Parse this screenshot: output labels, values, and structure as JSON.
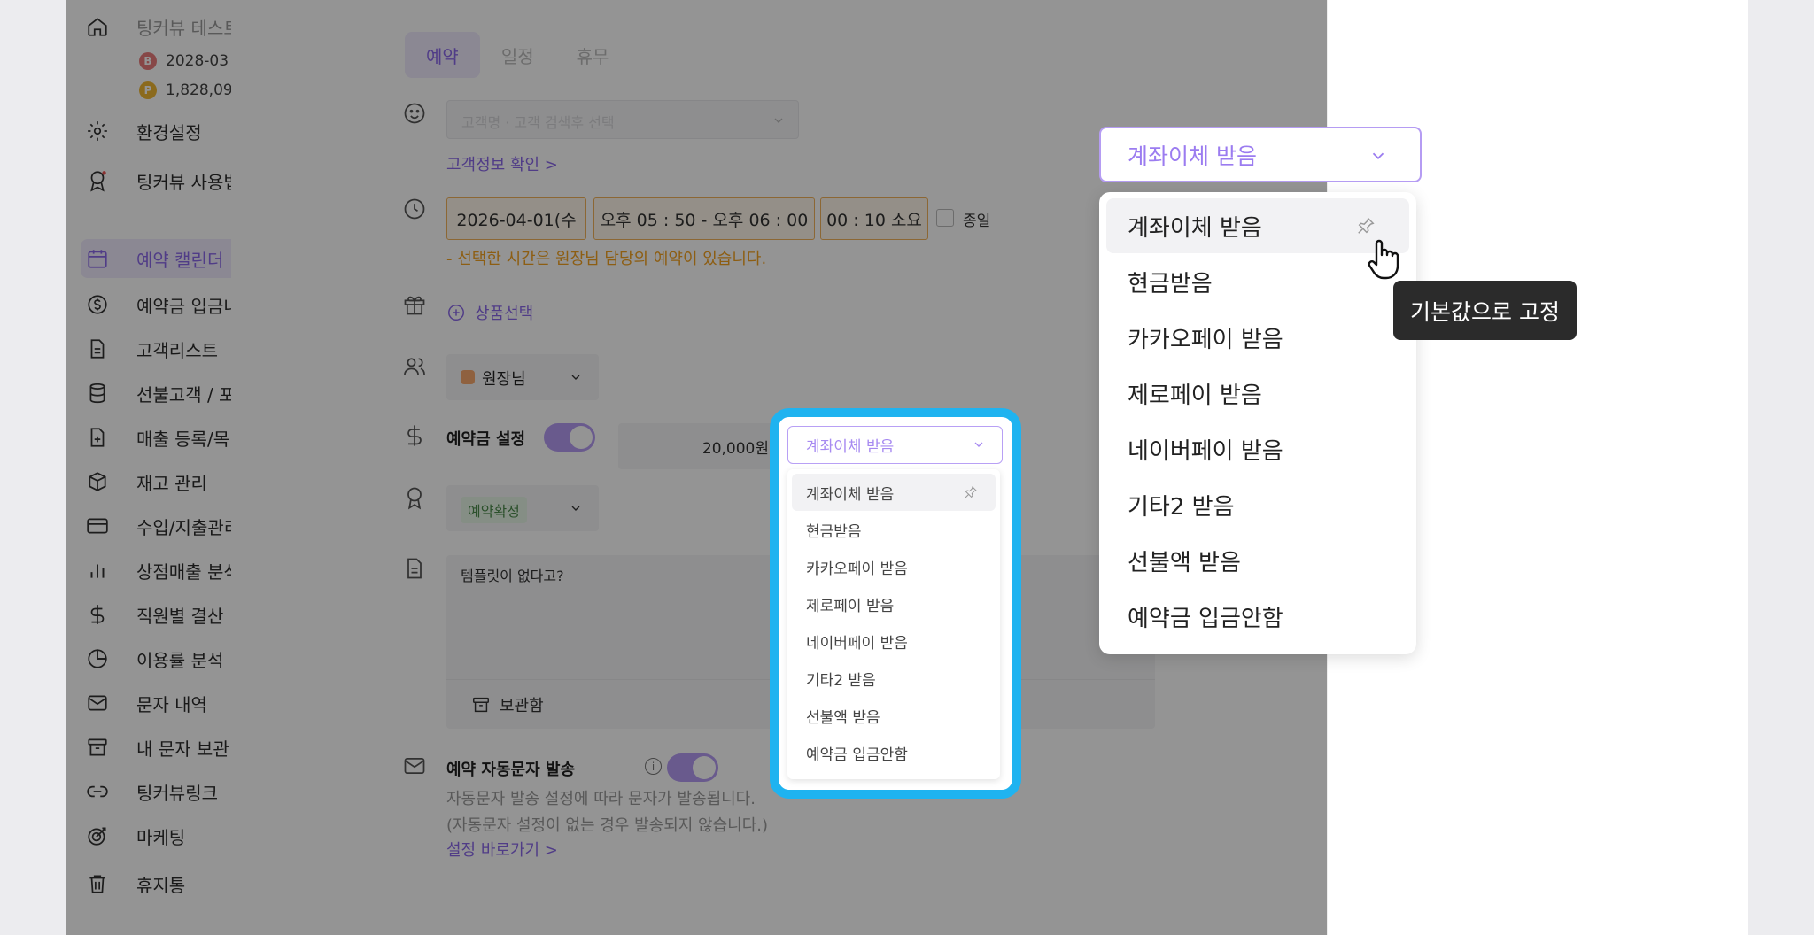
{
  "sidebar": {
    "top_name": "팅커뷰 테스트",
    "sub1": "2028-03",
    "sub2": "1,828,09",
    "items": [
      {
        "label": "환경설정"
      },
      {
        "label": "팅커뷰 사용법"
      },
      {
        "label": "예약 캘린더"
      },
      {
        "label": "예약금 입금내"
      },
      {
        "label": "고객리스트"
      },
      {
        "label": "선불고객 / 포"
      },
      {
        "label": "매출 등록/목"
      },
      {
        "label": "재고 관리"
      },
      {
        "label": "수입/지출관리"
      },
      {
        "label": "상점매출 분석"
      },
      {
        "label": "직원별 결산"
      },
      {
        "label": "이용률 분석"
      },
      {
        "label": "문자 내역"
      },
      {
        "label": "내 문자 보관"
      },
      {
        "label": "팅커뷰링크"
      },
      {
        "label": "마케팅"
      },
      {
        "label": "휴지통"
      }
    ]
  },
  "form": {
    "tabs": [
      "예약",
      "일정",
      "휴무"
    ],
    "customer_select": "고객명 · 고객 검색후 선택",
    "customer_link": "고객정보 확인 >",
    "date": "2026-04-01(수",
    "time_range": "오후 05 : 50 - 오후 06 : 00",
    "duration": "00 : 10 소요",
    "allday_label": "종일",
    "warning": "- 선택한 시간은 원장님 담당의 예약이 있습니다.",
    "product_label": "상품선택",
    "staff": "원장님",
    "deposit_label": "예약금 설정",
    "deposit_amount": "20,000원",
    "status_badge": "예약확정",
    "memo_text": "템플릿이 없다고?",
    "memo_storage": "보관함",
    "sms_label": "예약 자동문자 발송",
    "sms_desc1": "자동문자 발송 설정에 따라 문자가 발송됩니다.",
    "sms_desc2": "(자동문자 설정이 없는 경우 발송되지 않습니다.)",
    "sms_link": "설정 바로가기 >"
  },
  "small_dropdown": {
    "selected": "계좌이체 받음",
    "options": [
      "계좌이체 받음",
      "현금받음",
      "카카오페이 받음",
      "제로페이 받음",
      "네이버페이 받음",
      "기타2 받음",
      "선불액 받음",
      "예약금 입금안함"
    ]
  },
  "big_dropdown": {
    "selected": "계좌이체 받음",
    "options": [
      "계좌이체 받음",
      "현금받음",
      "카카오페이 받음",
      "제로페이 받음",
      "네이버페이 받음",
      "기타2 받음",
      "선불액 받음",
      "예약금 입금안함"
    ]
  },
  "tooltip": "기본값으로 고정",
  "colors": {
    "accent": "#8a68e9",
    "highlight": "#1fb3f0",
    "warning": "#f3a222"
  }
}
